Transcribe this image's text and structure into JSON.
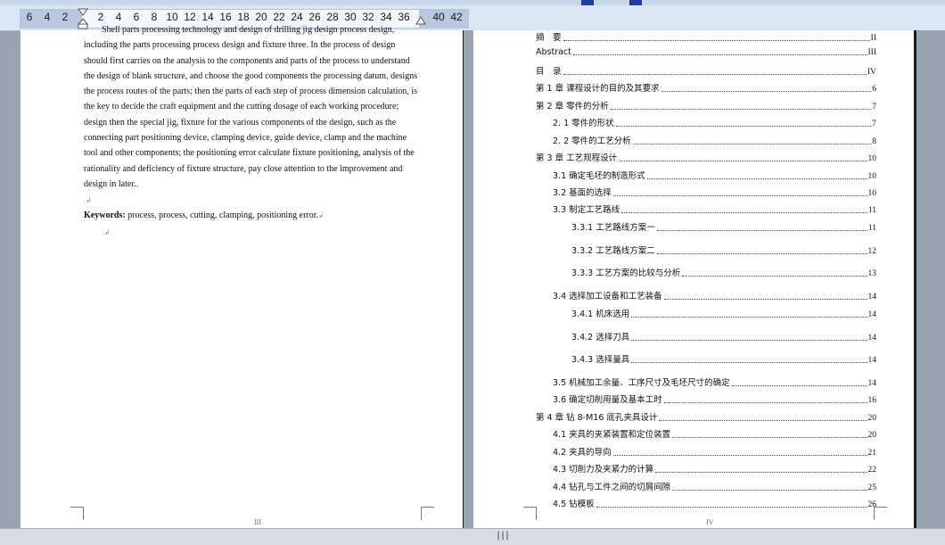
{
  "ruler": {
    "numbers": [
      "6",
      "4",
      "2",
      "2",
      "4",
      "6",
      "8",
      "10",
      "12",
      "14",
      "16",
      "18",
      "20",
      "22",
      "24",
      "26",
      "28",
      "30",
      "32",
      "34",
      "36",
      "40",
      "42"
    ]
  },
  "page_left": {
    "abstract_lines": [
      "Shell parts processing technology and design of drilling jig design process design,",
      "including the parts processing process design and fixture three. In the process of design",
      "should first carries on the analysis to the components and parts of the process to understand",
      "the design of blank structure, and choose the good components the processing datum, designs",
      "the process routes of the parts; then the parts of each step of process dimension calculation, is",
      "the key to decide the craft equipment and the cutting dosage of each working procedure;",
      "design then the special jig, fixture for the various components of the design, such as the",
      "connecting part positioning device, clamping device, guide device, clamp and the machine",
      "tool and other components; the positioning error calculate fixture positioning, analysis of the",
      "rationality and deficiency of fixture structure, pay close attention to the improvement and",
      "design in later.."
    ],
    "keywords_label": "Keywords:",
    "keywords_text": " process, process, cutting, clamping, positioning error.",
    "page_number": "III"
  },
  "page_right": {
    "toc": [
      {
        "title": "摘　要",
        "page": "II"
      },
      {
        "title": "Abstract",
        "page": "III"
      },
      {
        "title": "目　录",
        "page": "IV"
      },
      {
        "title": "第 1 章  课程设计的目的及其要求",
        "page": "6"
      },
      {
        "title": "第 2 章  零件的分析",
        "page": "7"
      },
      {
        "title": "2. 1 零件的形状",
        "page": "7"
      },
      {
        "title": "2. 2 零件的工艺分析",
        "page": "8"
      },
      {
        "title": "第 3 章  工艺规程设计",
        "page": "10"
      },
      {
        "title": "3.1  确定毛坯的制造形式",
        "page": "10"
      },
      {
        "title": "3.2  基面的选择",
        "page": "10"
      },
      {
        "title": "3.3  制定工艺路线",
        "page": "11"
      },
      {
        "title": "3.3.1  工艺路线方案一",
        "page": "11"
      },
      {
        "title": "3.3.2  工艺路线方案二",
        "page": "12"
      },
      {
        "title": "3.3.3  工艺方案的比较与分析",
        "page": "13"
      },
      {
        "title": "3.4  选择加工设备和工艺装备",
        "page": "14"
      },
      {
        "title": "3.4.1  机床选用",
        "page": "14"
      },
      {
        "title": "3.4.2  选择刀具",
        "page": "14"
      },
      {
        "title": "3.4.3  选择量具",
        "page": "14"
      },
      {
        "title": "3.5  机械加工余量、工序尺寸及毛坯尺寸的确定",
        "page": "14"
      },
      {
        "title": "3.6 确定切削用量及基本工时",
        "page": "16"
      },
      {
        "title": "第 4 章  钻 8-M16 底孔夹具设计",
        "page": "20"
      },
      {
        "title": "4.1  夹具的夹紧装置和定位装置",
        "page": "20"
      },
      {
        "title": "4.2  夹具的导向",
        "page": "21"
      },
      {
        "title": "4.3  切削力及夹紧力的计算",
        "page": "22"
      },
      {
        "title": "4.4  钻孔与工件之间的切屑间隙",
        "page": "25"
      },
      {
        "title": "4.5  钻模板",
        "page": "26"
      }
    ],
    "page_number": "IV"
  },
  "colors": {
    "ruler_bg": "#dbe6f4",
    "workspace_bg": "#9aa3b0",
    "page_bg": "#ffffff",
    "tab_marker": "#1f3f9a"
  }
}
